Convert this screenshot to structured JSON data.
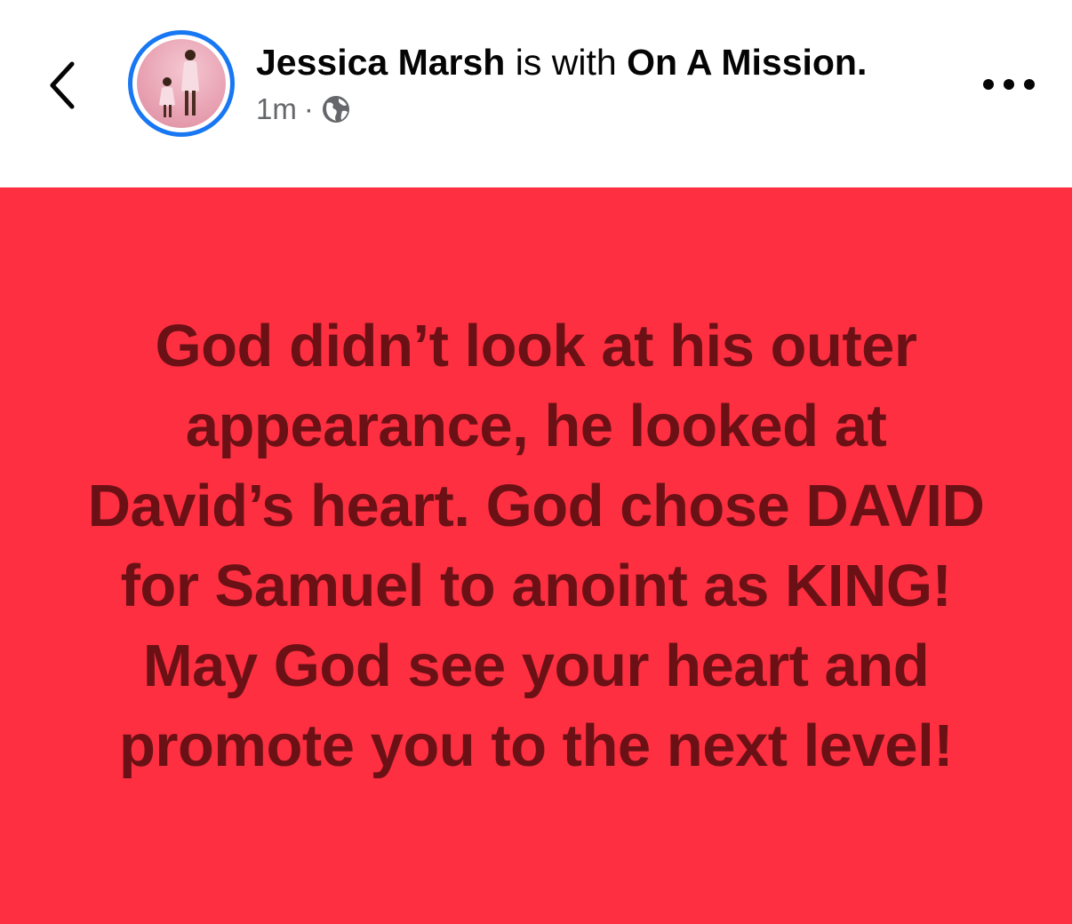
{
  "header": {
    "author_name": "Jessica Marsh",
    "connector": " is with ",
    "tagged": "On A Mission.",
    "time": "1m",
    "separator": "·",
    "privacy_icon": "globe-icon",
    "back_icon": "chevron-left-icon",
    "more_icon": "more-horizontal-icon"
  },
  "post": {
    "text": "God didn’t look at his outer appearance, he looked at David’s heart. God chose DAVID for Samuel to anoint as KING! May God see your heart and promote you to the next level!",
    "background_color": "#FD2F40",
    "text_color": "#6B1116"
  },
  "colors": {
    "story_ring": "#1877F2",
    "primary_text": "#050505",
    "secondary_text": "#65676B"
  }
}
